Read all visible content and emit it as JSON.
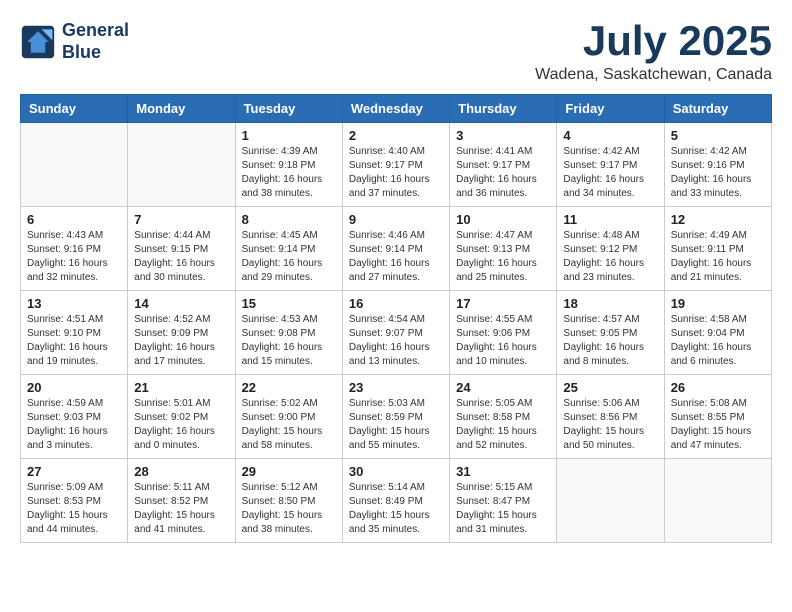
{
  "header": {
    "logo_line1": "General",
    "logo_line2": "Blue",
    "month": "July 2025",
    "location": "Wadena, Saskatchewan, Canada"
  },
  "weekdays": [
    "Sunday",
    "Monday",
    "Tuesday",
    "Wednesday",
    "Thursday",
    "Friday",
    "Saturday"
  ],
  "weeks": [
    [
      {
        "day": "",
        "sunrise": "",
        "sunset": "",
        "daylight": ""
      },
      {
        "day": "",
        "sunrise": "",
        "sunset": "",
        "daylight": ""
      },
      {
        "day": "1",
        "sunrise": "Sunrise: 4:39 AM",
        "sunset": "Sunset: 9:18 PM",
        "daylight": "Daylight: 16 hours and 38 minutes."
      },
      {
        "day": "2",
        "sunrise": "Sunrise: 4:40 AM",
        "sunset": "Sunset: 9:17 PM",
        "daylight": "Daylight: 16 hours and 37 minutes."
      },
      {
        "day": "3",
        "sunrise": "Sunrise: 4:41 AM",
        "sunset": "Sunset: 9:17 PM",
        "daylight": "Daylight: 16 hours and 36 minutes."
      },
      {
        "day": "4",
        "sunrise": "Sunrise: 4:42 AM",
        "sunset": "Sunset: 9:17 PM",
        "daylight": "Daylight: 16 hours and 34 minutes."
      },
      {
        "day": "5",
        "sunrise": "Sunrise: 4:42 AM",
        "sunset": "Sunset: 9:16 PM",
        "daylight": "Daylight: 16 hours and 33 minutes."
      }
    ],
    [
      {
        "day": "6",
        "sunrise": "Sunrise: 4:43 AM",
        "sunset": "Sunset: 9:16 PM",
        "daylight": "Daylight: 16 hours and 32 minutes."
      },
      {
        "day": "7",
        "sunrise": "Sunrise: 4:44 AM",
        "sunset": "Sunset: 9:15 PM",
        "daylight": "Daylight: 16 hours and 30 minutes."
      },
      {
        "day": "8",
        "sunrise": "Sunrise: 4:45 AM",
        "sunset": "Sunset: 9:14 PM",
        "daylight": "Daylight: 16 hours and 29 minutes."
      },
      {
        "day": "9",
        "sunrise": "Sunrise: 4:46 AM",
        "sunset": "Sunset: 9:14 PM",
        "daylight": "Daylight: 16 hours and 27 minutes."
      },
      {
        "day": "10",
        "sunrise": "Sunrise: 4:47 AM",
        "sunset": "Sunset: 9:13 PM",
        "daylight": "Daylight: 16 hours and 25 minutes."
      },
      {
        "day": "11",
        "sunrise": "Sunrise: 4:48 AM",
        "sunset": "Sunset: 9:12 PM",
        "daylight": "Daylight: 16 hours and 23 minutes."
      },
      {
        "day": "12",
        "sunrise": "Sunrise: 4:49 AM",
        "sunset": "Sunset: 9:11 PM",
        "daylight": "Daylight: 16 hours and 21 minutes."
      }
    ],
    [
      {
        "day": "13",
        "sunrise": "Sunrise: 4:51 AM",
        "sunset": "Sunset: 9:10 PM",
        "daylight": "Daylight: 16 hours and 19 minutes."
      },
      {
        "day": "14",
        "sunrise": "Sunrise: 4:52 AM",
        "sunset": "Sunset: 9:09 PM",
        "daylight": "Daylight: 16 hours and 17 minutes."
      },
      {
        "day": "15",
        "sunrise": "Sunrise: 4:53 AM",
        "sunset": "Sunset: 9:08 PM",
        "daylight": "Daylight: 16 hours and 15 minutes."
      },
      {
        "day": "16",
        "sunrise": "Sunrise: 4:54 AM",
        "sunset": "Sunset: 9:07 PM",
        "daylight": "Daylight: 16 hours and 13 minutes."
      },
      {
        "day": "17",
        "sunrise": "Sunrise: 4:55 AM",
        "sunset": "Sunset: 9:06 PM",
        "daylight": "Daylight: 16 hours and 10 minutes."
      },
      {
        "day": "18",
        "sunrise": "Sunrise: 4:57 AM",
        "sunset": "Sunset: 9:05 PM",
        "daylight": "Daylight: 16 hours and 8 minutes."
      },
      {
        "day": "19",
        "sunrise": "Sunrise: 4:58 AM",
        "sunset": "Sunset: 9:04 PM",
        "daylight": "Daylight: 16 hours and 6 minutes."
      }
    ],
    [
      {
        "day": "20",
        "sunrise": "Sunrise: 4:59 AM",
        "sunset": "Sunset: 9:03 PM",
        "daylight": "Daylight: 16 hours and 3 minutes."
      },
      {
        "day": "21",
        "sunrise": "Sunrise: 5:01 AM",
        "sunset": "Sunset: 9:02 PM",
        "daylight": "Daylight: 16 hours and 0 minutes."
      },
      {
        "day": "22",
        "sunrise": "Sunrise: 5:02 AM",
        "sunset": "Sunset: 9:00 PM",
        "daylight": "Daylight: 15 hours and 58 minutes."
      },
      {
        "day": "23",
        "sunrise": "Sunrise: 5:03 AM",
        "sunset": "Sunset: 8:59 PM",
        "daylight": "Daylight: 15 hours and 55 minutes."
      },
      {
        "day": "24",
        "sunrise": "Sunrise: 5:05 AM",
        "sunset": "Sunset: 8:58 PM",
        "daylight": "Daylight: 15 hours and 52 minutes."
      },
      {
        "day": "25",
        "sunrise": "Sunrise: 5:06 AM",
        "sunset": "Sunset: 8:56 PM",
        "daylight": "Daylight: 15 hours and 50 minutes."
      },
      {
        "day": "26",
        "sunrise": "Sunrise: 5:08 AM",
        "sunset": "Sunset: 8:55 PM",
        "daylight": "Daylight: 15 hours and 47 minutes."
      }
    ],
    [
      {
        "day": "27",
        "sunrise": "Sunrise: 5:09 AM",
        "sunset": "Sunset: 8:53 PM",
        "daylight": "Daylight: 15 hours and 44 minutes."
      },
      {
        "day": "28",
        "sunrise": "Sunrise: 5:11 AM",
        "sunset": "Sunset: 8:52 PM",
        "daylight": "Daylight: 15 hours and 41 minutes."
      },
      {
        "day": "29",
        "sunrise": "Sunrise: 5:12 AM",
        "sunset": "Sunset: 8:50 PM",
        "daylight": "Daylight: 15 hours and 38 minutes."
      },
      {
        "day": "30",
        "sunrise": "Sunrise: 5:14 AM",
        "sunset": "Sunset: 8:49 PM",
        "daylight": "Daylight: 15 hours and 35 minutes."
      },
      {
        "day": "31",
        "sunrise": "Sunrise: 5:15 AM",
        "sunset": "Sunset: 8:47 PM",
        "daylight": "Daylight: 15 hours and 31 minutes."
      },
      {
        "day": "",
        "sunrise": "",
        "sunset": "",
        "daylight": ""
      },
      {
        "day": "",
        "sunrise": "",
        "sunset": "",
        "daylight": ""
      }
    ]
  ]
}
